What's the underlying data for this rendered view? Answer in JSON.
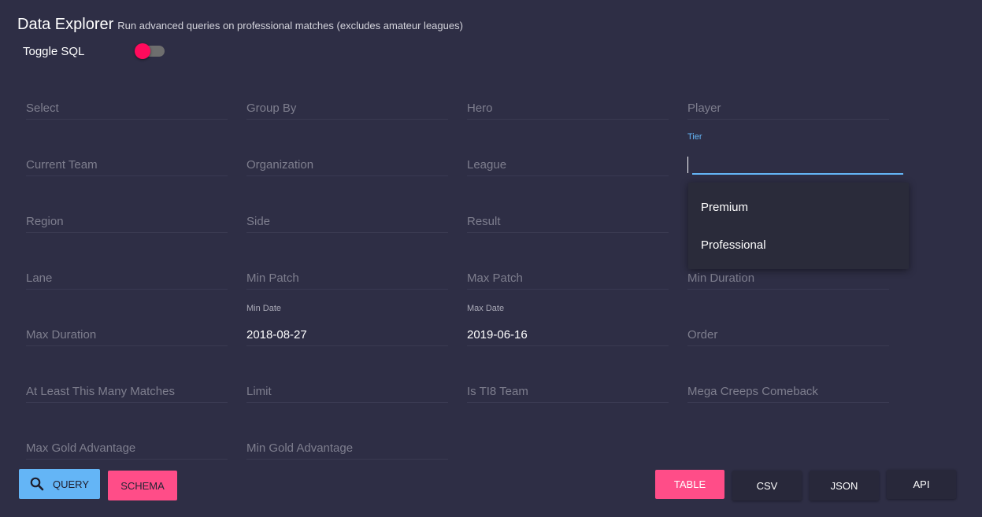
{
  "header": {
    "title": "Data Explorer",
    "subtitle": "Run advanced queries on professional matches (excludes amateur leagues)"
  },
  "sql_toggle": {
    "label": "Toggle SQL",
    "enabled": false,
    "thumb_color": "#ff0a5c"
  },
  "fields": {
    "select": {
      "placeholder": "Select"
    },
    "group_by": {
      "placeholder": "Group By"
    },
    "hero": {
      "placeholder": "Hero"
    },
    "player": {
      "placeholder": "Player"
    },
    "current_team": {
      "placeholder": "Current Team"
    },
    "organization": {
      "placeholder": "Organization"
    },
    "league": {
      "placeholder": "League"
    },
    "tier": {
      "label": "Tier",
      "value": ""
    },
    "region": {
      "placeholder": "Region"
    },
    "side": {
      "placeholder": "Side"
    },
    "result": {
      "placeholder": "Result"
    },
    "lane": {
      "placeholder": "Lane"
    },
    "min_patch": {
      "placeholder": "Min Patch"
    },
    "max_patch": {
      "placeholder": "Max Patch"
    },
    "min_duration": {
      "placeholder": "Min Duration"
    },
    "max_duration": {
      "placeholder": "Max Duration"
    },
    "min_date": {
      "label": "Min Date",
      "value": "2018-08-27"
    },
    "max_date": {
      "label": "Max Date",
      "value": "2019-06-16"
    },
    "order": {
      "placeholder": "Order"
    },
    "min_matches": {
      "placeholder": "At Least This Many Matches"
    },
    "limit": {
      "placeholder": "Limit"
    },
    "is_ti8_team": {
      "placeholder": "Is TI8 Team"
    },
    "mega_creeps_comeback": {
      "placeholder": "Mega Creeps Comeback"
    },
    "max_gold_advantage": {
      "placeholder": "Max Gold Advantage"
    },
    "min_gold_advantage": {
      "placeholder": "Min Gold Advantage"
    }
  },
  "tier_dropdown": {
    "options": [
      "Premium",
      "Professional"
    ]
  },
  "actions": {
    "query_label": "QUERY",
    "schema_label": "SCHEMA"
  },
  "output_formats": {
    "table_label": "TABLE",
    "csv_label": "CSV",
    "json_label": "JSON",
    "api_label": "API"
  },
  "colors": {
    "background": "#2e2e45",
    "accent_blue": "#64b5f6",
    "accent_pink": "#ff4d88"
  },
  "icons": {
    "query_button_icon": "search-icon"
  }
}
